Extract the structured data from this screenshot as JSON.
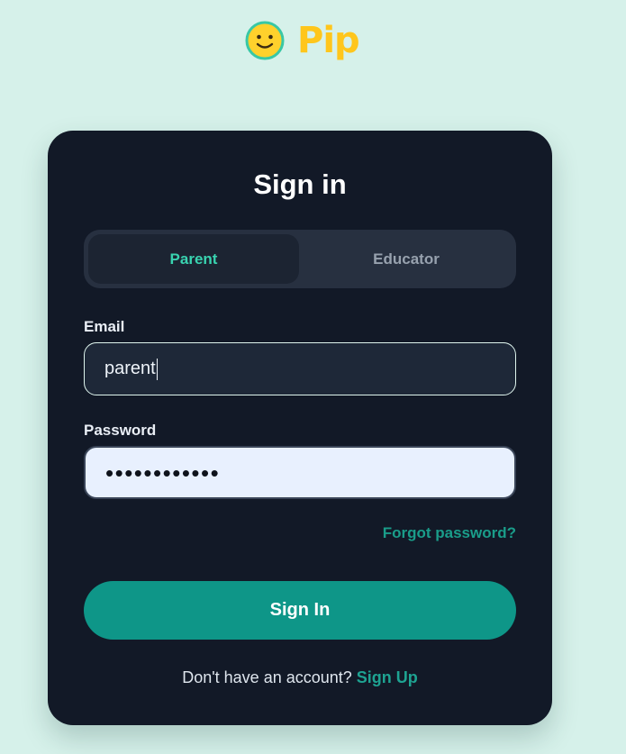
{
  "brand": {
    "icon": "smiley-face-icon",
    "name": "Pip",
    "colors": {
      "name": "#ffc61c",
      "icon_face": "#ffd12c",
      "icon_ring": "#39c8a5"
    }
  },
  "card": {
    "title": "Sign in",
    "background": "#121927"
  },
  "tabs": {
    "items": [
      {
        "label": "Parent",
        "selected": true
      },
      {
        "label": "Educator",
        "selected": false
      }
    ],
    "selected_color": "#39d3b0"
  },
  "form": {
    "email_label": "Email",
    "email_value": "parent",
    "password_label": "Password",
    "password_masked": "••••••••••••",
    "forgot_password": "Forgot password?"
  },
  "actions": {
    "sign_in_label": "Sign In",
    "button_color": "#0e9688"
  },
  "footer": {
    "prompt": "Don't have an account?",
    "sign_up_link": "Sign Up"
  }
}
